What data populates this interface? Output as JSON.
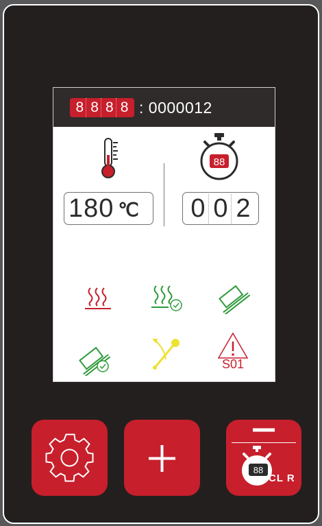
{
  "header": {
    "segment_digits": [
      "8",
      "8",
      "8",
      "8"
    ],
    "counter_text": ": 0000012"
  },
  "temperature": {
    "value": "180",
    "unit": "℃"
  },
  "timer": {
    "icon_digits": "88",
    "digits": [
      "0",
      "0",
      "2"
    ]
  },
  "status_icons": {
    "alarm_code": "S01"
  },
  "buttons": {
    "timer_clear_label": "CL R",
    "timer_display_digits": "88"
  },
  "colors": {
    "accent_red": "#c71f2c",
    "status_green": "#2e9a3a",
    "status_yellow": "#ede131",
    "panel_dark": "#231f1e"
  }
}
